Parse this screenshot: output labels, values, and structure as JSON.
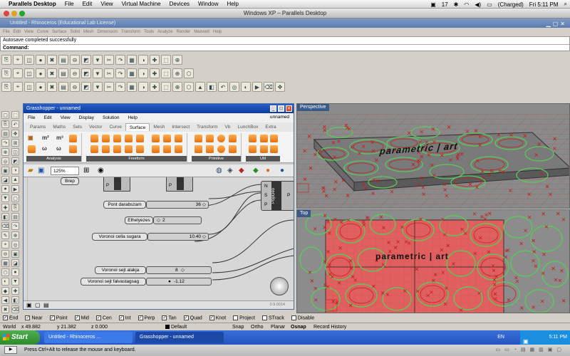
{
  "mac_menu": {
    "app": "Parallels Desktop",
    "items": [
      "File",
      "Edit",
      "View",
      "Virtual Machine",
      "Devices",
      "Window",
      "Help"
    ],
    "battery_num": "17",
    "status": "(Charged)",
    "clock": "Fri 5:11 PM"
  },
  "window_title": "Windows XP – Parallels Desktop",
  "rhino": {
    "title": "Untitled - Rhinoceros (Educational Lab License)",
    "menu": [
      "File",
      "Edit",
      "View",
      "Curve",
      "Surface",
      "Solid",
      "Mesh",
      "Dimension",
      "Transform",
      "Tools",
      "Analyze",
      "Render",
      "Maxwell",
      "Help"
    ],
    "command_history": "Autosave completed successfully",
    "command_label": "Command:"
  },
  "grasshopper": {
    "title": "Grasshopper - unnamed",
    "file_label": "unnamed",
    "menu": [
      "File",
      "Edit",
      "View",
      "Display",
      "Solution",
      "Help"
    ],
    "tabs": [
      "Params",
      "Maths",
      "Sets",
      "Vector",
      "Curve",
      "Surface",
      "Mesh",
      "Intersect",
      "Transform",
      "Vb",
      "LunchBox",
      "Extra"
    ],
    "active_tab": "Surface",
    "ribbon_groups": [
      "Analysis",
      "Freeform",
      "Primitive",
      "Util"
    ],
    "zoom": "125%",
    "components": {
      "brep": "Brep",
      "popgeo": "PopGeo",
      "nsp": [
        "N",
        "S",
        "P"
      ],
      "out": "P"
    },
    "sliders": [
      {
        "label": "Pont darabszam",
        "value": "36"
      },
      {
        "label": "Elhelyezes",
        "value": "2"
      },
      {
        "label": "Voronoi cella sugara",
        "value": "10.40"
      },
      {
        "label": "Voronoi sejt alakja",
        "value": "8"
      },
      {
        "label": "Voronoi sejt falvastagsag",
        "value": "-1.12"
      }
    ],
    "version": "0.9.0014"
  },
  "viewports": {
    "perspective": "Perspective",
    "top": "Top",
    "perspective_text": "parametric | art",
    "top_text": "parametric | art"
  },
  "osnap": [
    {
      "label": "End",
      "checked": true
    },
    {
      "label": "Near",
      "checked": true
    },
    {
      "label": "Point",
      "checked": true
    },
    {
      "label": "Mid",
      "checked": true
    },
    {
      "label": "Cen",
      "checked": true
    },
    {
      "label": "Int",
      "checked": true
    },
    {
      "label": "Perp",
      "checked": true
    },
    {
      "label": "Tan",
      "checked": true
    },
    {
      "label": "Quad",
      "checked": true
    },
    {
      "label": "Knot",
      "checked": true
    },
    {
      "label": "Project",
      "checked": false
    },
    {
      "label": "STrack",
      "checked": false
    },
    {
      "label": "Disable",
      "checked": false
    }
  ],
  "status": {
    "world": "World",
    "x": "x 49.882",
    "y": "y 21.382",
    "z": "z 0.000",
    "layer": "Default",
    "toggles": [
      "Snap",
      "Ortho",
      "Planar",
      "Osnap",
      "Record History"
    ]
  },
  "taskbar": {
    "start": "Start",
    "tasks": [
      "Untitled - Rhinoceros ...",
      "Grasshopper - unnamed"
    ],
    "lang": "EN",
    "clock": "5:11 PM"
  },
  "footer": "Press Ctrl+Alt to release the mouse and keyboard.",
  "colors": {
    "xp_blue": "#2454c0",
    "rhino_title": "#5c7bb0",
    "gh_title": "#0a3aa0",
    "grid_red": "#b83030",
    "curve_green": "#5cc85c"
  }
}
